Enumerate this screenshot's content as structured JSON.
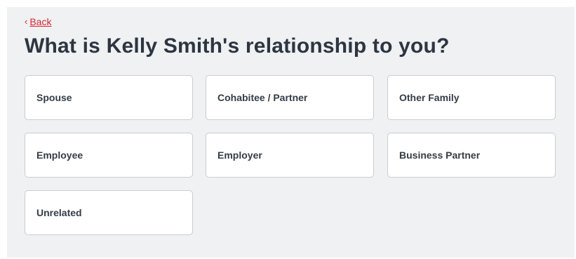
{
  "back": {
    "chevron": "‹",
    "label": "Back"
  },
  "question": {
    "title": "What is Kelly Smith's relationship to you?"
  },
  "options": [
    {
      "label": "Spouse"
    },
    {
      "label": "Cohabitee / Partner"
    },
    {
      "label": "Other Family"
    },
    {
      "label": "Employee"
    },
    {
      "label": "Employer"
    },
    {
      "label": "Business Partner"
    },
    {
      "label": "Unrelated"
    }
  ],
  "colors": {
    "accent": "#d9252b",
    "panel_background": "#eff1f3",
    "title_text": "#2d3540",
    "option_border": "#c9ccd1"
  }
}
